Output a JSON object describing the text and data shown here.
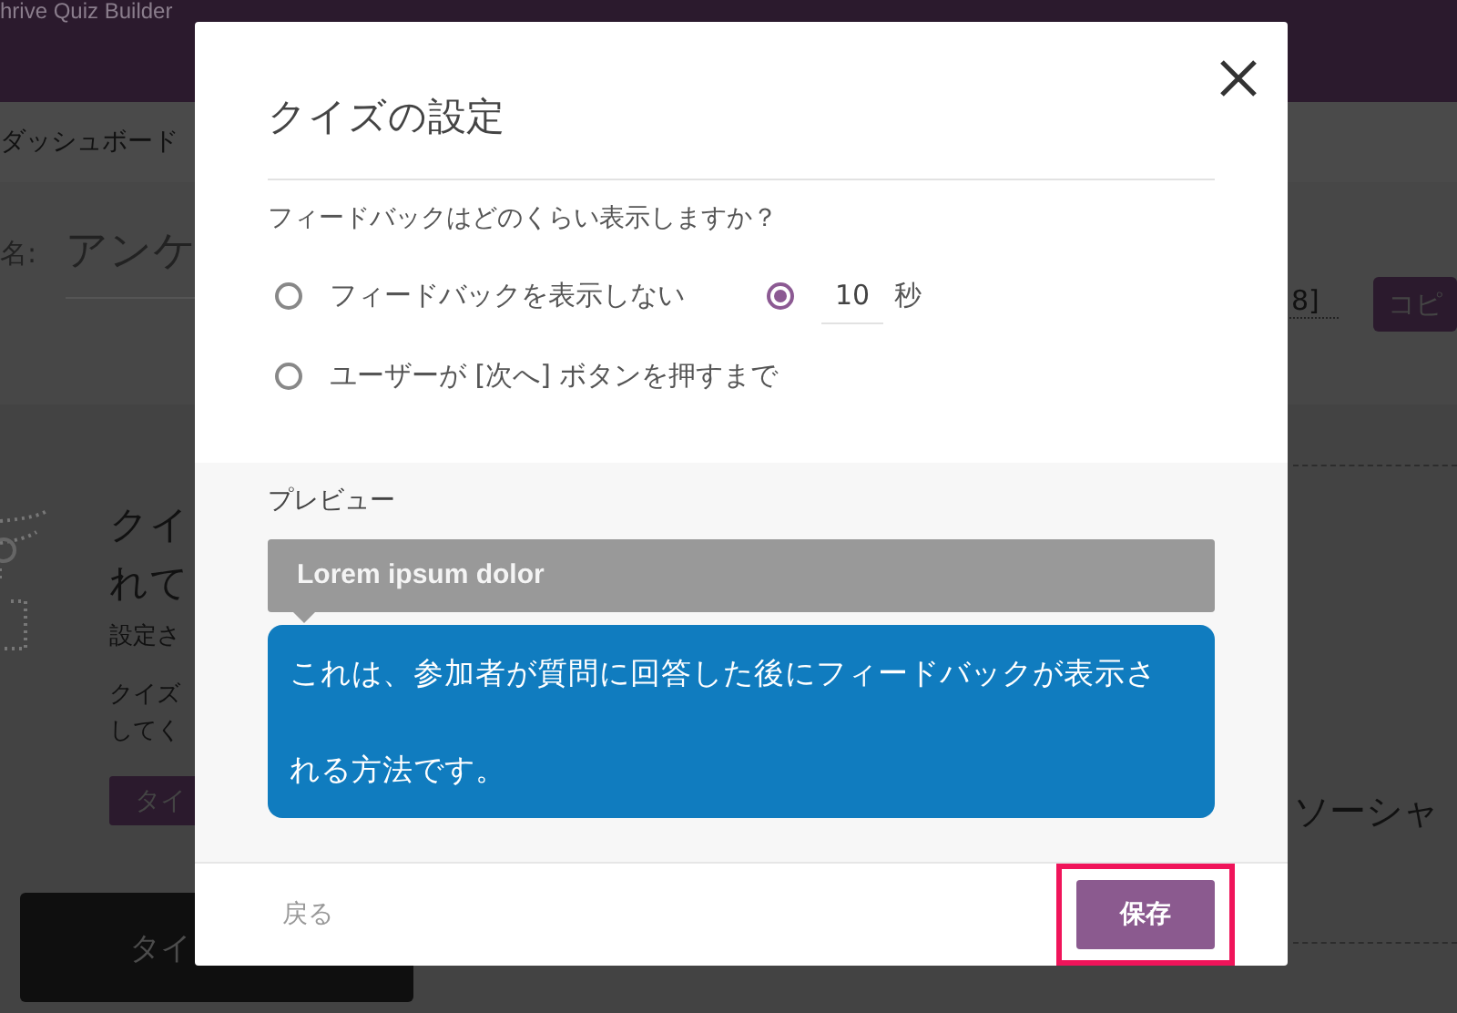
{
  "background": {
    "app_title": "hrive Quiz Builder",
    "breadcrumb": "ダッシュボード",
    "name_label": "名:",
    "name_value": "アンケ",
    "shortcode_fragment": "8]",
    "copy_button": "コピ",
    "empty_state": {
      "heading_lines": [
        "クイ",
        "れて"
      ],
      "subtitle": "設定さ",
      "body_lines": [
        "クイズ",
        "してく"
      ],
      "primary_button": "タイ"
    },
    "dark_button": "タイ",
    "social_fragment": "ソーシャ"
  },
  "dialog": {
    "title": "クイズの設定",
    "question": "フィードバックはどのくらい表示しますか？",
    "options": [
      {
        "kind": "radio",
        "label": "フィードバックを表示しない",
        "selected": false
      },
      {
        "kind": "timed",
        "value": "10",
        "unit": "秒",
        "selected": true
      },
      {
        "kind": "radio",
        "label": "ユーザーが [次へ] ボタンを押すまで",
        "selected": false
      }
    ],
    "preview": {
      "label": "プレビュー",
      "question": "Lorem ipsum dolor",
      "feedback": "これは、参加者が質問に回答した後にフィードバックが表示される方法です。"
    },
    "back_button": "戻る",
    "save_button": {
      "label": "保存",
      "highlighted": true
    }
  }
}
